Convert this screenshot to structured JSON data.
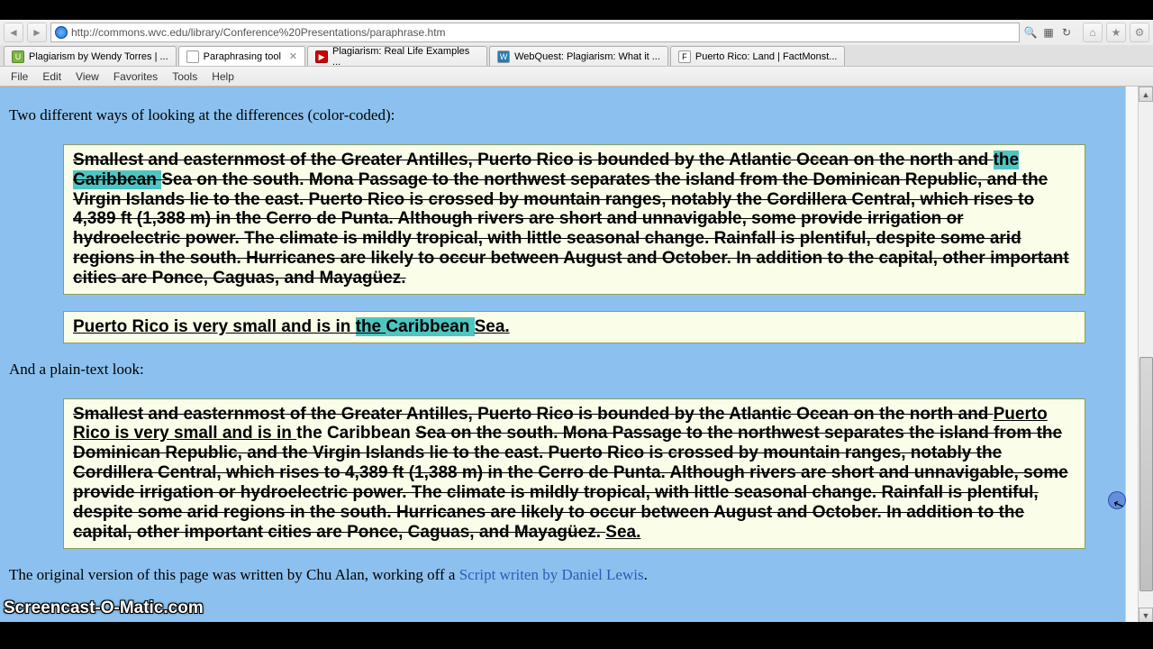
{
  "url": "http://commons.wvc.edu/library/Conference%20Presentations/paraphrase.htm",
  "tabs": [
    {
      "label": "Plagiarism by Wendy Torres | ...",
      "fav": "U"
    },
    {
      "label": "Paraphrasing tool",
      "fav": "",
      "active": true
    },
    {
      "label": "Plagiarism: Real Life Examples ...",
      "fav": "▶"
    },
    {
      "label": "WebQuest: Plagiarism: What it ...",
      "fav": "W"
    },
    {
      "label": "Puerto Rico: Land | FactMonst...",
      "fav": "F"
    }
  ],
  "menu": [
    "File",
    "Edit",
    "View",
    "Favorites",
    "Tools",
    "Help"
  ],
  "heading1": "Two different ways of looking at the differences (color-coded):",
  "box1": {
    "seg1_strike": "Smallest and easternmost of the Greater Antilles, Puerto Rico is bounded by the Atlantic Ocean on the north and ",
    "seg2_hl": "the ",
    "seg3_hl_newline_strike": "Caribbean ",
    "seg4_strike": "Sea on the south. Mona Passage to the northwest separates the island from the Dominican Republic, and the Virgin Islands lie to the east. Puerto Rico is crossed by mountain ranges, notably the Cordillera Central, which rises to 4,389 ft (1,388 m) in the Cerro de Punta. Although rivers are short and unnavigable, some provide irrigation or hydroelectric power. The climate is mildly tropical, with little seasonal change. Rainfall is plentiful, despite some arid regions in the south. Hurricanes are likely to occur between August and October. In addition to the capital, other important cities are Ponce, Caguas, and Mayagüez."
  },
  "box2": {
    "pre": "Puerto Rico is very small and is in ",
    "hl1": "the ",
    "hl2": "Caribbean ",
    "post": "Sea."
  },
  "heading2": "And a plain-text look:",
  "box3": {
    "s1": "Smallest and easternmost of the Greater Antilles, Puerto Rico is bounded by the Atlantic Ocean on the north and ",
    "u1": "Puerto Rico is very small and is in ",
    "t1": "the Caribbean ",
    "s2": "Sea on the south. Mona Passage to the northwest separates the island from the Dominican Republic, and the Virgin Islands lie to the east. Puerto Rico is crossed by mountain ranges, notably the Cordillera Central, which rises to 4,389 ft (1,388 m) in the Cerro de Punta. Although rivers are short and unnavigable, some provide irrigation or hydroelectric power. The climate is mildly tropical, with little seasonal change. Rainfall is plentiful, despite some arid regions in the south. Hurricanes are likely to occur between August and October. In addition to the capital, other important cities are Ponce, Caguas, and Mayagüez. ",
    "u2": "Sea."
  },
  "footer_pre": "The original version of this page was written by Chu Alan, working off a ",
  "footer_link": "Script writen by Daniel Lewis",
  "footer_post": ".",
  "watermark": "Screencast-O-Matic.com"
}
